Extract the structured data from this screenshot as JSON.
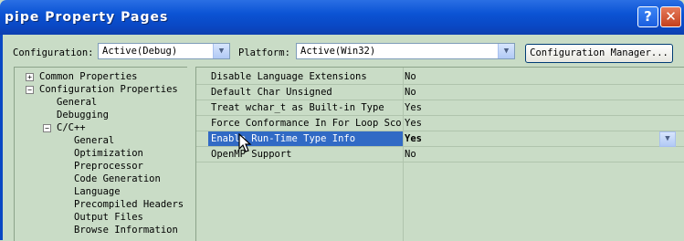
{
  "window": {
    "title": "pipe Property Pages",
    "help": "?",
    "close": "✕"
  },
  "config_bar": {
    "configuration_label": "Configuration:",
    "configuration_value": "Active(Debug)",
    "platform_label": "Platform:",
    "platform_value": "Active(Win32)",
    "config_manager_label": "Configuration Manager..."
  },
  "tree": {
    "common": "Common Properties",
    "configuration": "Configuration Properties",
    "general": "General",
    "debugging": "Debugging",
    "cpp": "C/C++",
    "cpp_items": [
      "General",
      "Optimization",
      "Preprocessor",
      "Code Generation",
      "Language",
      "Precompiled Headers",
      "Output Files",
      "Browse Information"
    ]
  },
  "properties": [
    {
      "name": "Disable Language Extensions",
      "value": "No"
    },
    {
      "name": "Default Char Unsigned",
      "value": "No"
    },
    {
      "name": "Treat wchar_t as Built-in Type",
      "value": "Yes"
    },
    {
      "name": "Force Conformance In For Loop Scope",
      "value": "Yes"
    },
    {
      "name": "Enable Run-Time Type Info",
      "value": "Yes"
    },
    {
      "name": "OpenMP Support",
      "value": "No"
    }
  ],
  "icons": {
    "dropdown": "chevron-down-icon",
    "cursor": "mouse-pointer-icon"
  },
  "colors": {
    "titlebar": "#0b53d4",
    "panel": "#c9dcc6",
    "selection": "#316ac5"
  }
}
